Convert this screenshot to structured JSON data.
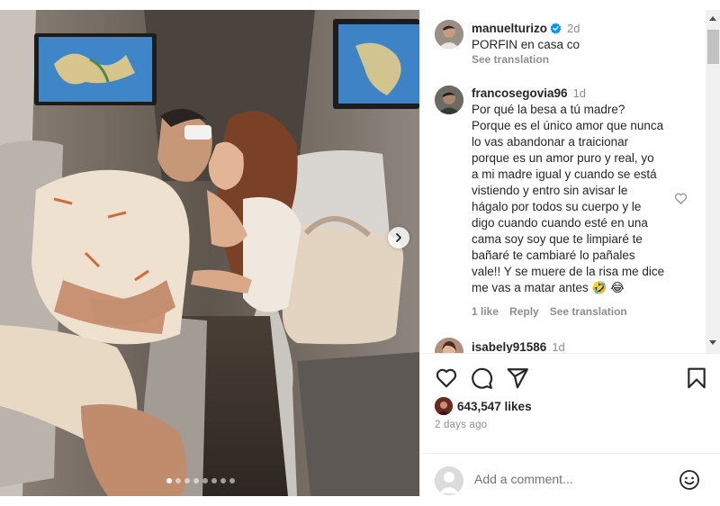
{
  "post": {
    "author": "manuelturizo",
    "caption_time": "2d",
    "caption": "PORFIN en casa co",
    "caption_see_translation": "See translation",
    "carousel_count": 8,
    "carousel_active": 0
  },
  "comments": [
    {
      "username": "francosegovia96",
      "time": "1d",
      "text": "Por qué la besa a tú madre?\nPorque es el único amor que nunca\nlo vas abandonar a traicionar\nporque es un amor puro y real, yo\na mi madre igual y cuando se está\nvistiendo y entro sin avisar le\nhágalo por todos su cuerpo y le\ndigo cuando cuando esté en una\ncama soy soy que te limpiaré te\nbañaré te cambiaré lo pañales\nvale!! Y se muere de la risa me dice\nme vas a matar antes 🤣 😂",
      "likes": "1 like",
      "reply": "Reply",
      "see_translation": "See translation"
    },
    {
      "username": "isabely91586",
      "time": "1d"
    }
  ],
  "actions": {
    "likes": "643,547 likes",
    "posted_ago": "2 days ago",
    "add_comment_placeholder": "Add a comment..."
  },
  "colors": {
    "verified": "#0095f6",
    "text": "#262626",
    "secondary": "#8e8e8e"
  },
  "icons": {
    "like": "heart-icon",
    "comment": "comment-bubble-icon",
    "share": "paper-plane-icon",
    "save": "bookmark-icon",
    "emoji": "smiley-icon",
    "next": "chevron-right-icon"
  }
}
